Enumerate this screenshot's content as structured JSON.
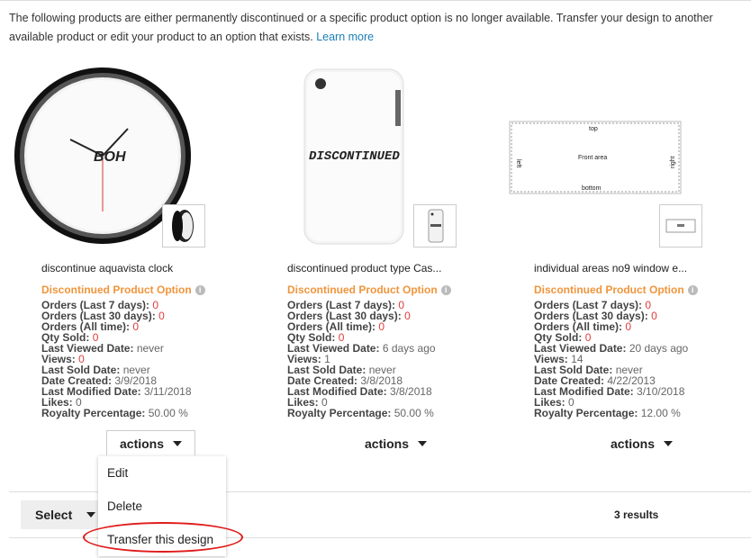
{
  "notice": {
    "text": "The following products are either permanently discontinued or a specific product option is no longer available. Transfer your design to another available product or edit your product to an option that exists.",
    "link": "Learn more"
  },
  "products": [
    {
      "name": "discontinue aquavista clock",
      "clock_text": "BOH",
      "status": "Discontinued Product Option",
      "stats": [
        {
          "k": "Orders (Last 7 days):",
          "v": "0",
          "red": true
        },
        {
          "k": "Orders (Last 30 days):",
          "v": "0",
          "red": true
        },
        {
          "k": "Orders (All time):",
          "v": "0",
          "red": true
        },
        {
          "k": "Qty Sold:",
          "v": "0",
          "red": true
        },
        {
          "k": "Last Viewed Date:",
          "v": "never",
          "red": false
        },
        {
          "k": "Views:",
          "v": "0",
          "red": true
        },
        {
          "k": "Last Sold Date:",
          "v": "never",
          "red": false
        },
        {
          "k": "Date Created:",
          "v": "3/9/2018",
          "red": false
        },
        {
          "k": "Last Modified Date:",
          "v": "3/11/2018",
          "red": false
        },
        {
          "k": "Likes:",
          "v": "0",
          "red": false
        },
        {
          "k": "Royalty Percentage:",
          "v": "50.00 %",
          "red": false
        }
      ],
      "actions": "actions"
    },
    {
      "name": "discontinued product type Cas...",
      "case_text": "DISCONTINUED",
      "status": "Discontinued Product Option",
      "stats": [
        {
          "k": "Orders (Last 7 days):",
          "v": "0",
          "red": true
        },
        {
          "k": "Orders (Last 30 days):",
          "v": "0",
          "red": true
        },
        {
          "k": "Orders (All time):",
          "v": "0",
          "red": true
        },
        {
          "k": "Qty Sold:",
          "v": "0",
          "red": true
        },
        {
          "k": "Last Viewed Date:",
          "v": "6 days ago",
          "red": false
        },
        {
          "k": "Views:",
          "v": "1",
          "red": false
        },
        {
          "k": "Last Sold Date:",
          "v": "never",
          "red": false
        },
        {
          "k": "Date Created:",
          "v": "3/8/2018",
          "red": false
        },
        {
          "k": "Last Modified Date:",
          "v": "3/8/2018",
          "red": false
        },
        {
          "k": "Likes:",
          "v": "0",
          "red": false
        },
        {
          "k": "Royalty Percentage:",
          "v": "50.00 %",
          "red": false
        }
      ],
      "actions": "actions"
    },
    {
      "name": "individual areas no9 window e...",
      "panel_labels": {
        "top": "top",
        "left": "left",
        "right": "right",
        "bottom": "bottom",
        "front": "Front area"
      },
      "status": "Discontinued Product Option",
      "stats": [
        {
          "k": "Orders (Last 7 days):",
          "v": "0",
          "red": true
        },
        {
          "k": "Orders (Last 30 days):",
          "v": "0",
          "red": true
        },
        {
          "k": "Orders (All time):",
          "v": "0",
          "red": true
        },
        {
          "k": "Qty Sold:",
          "v": "0",
          "red": true
        },
        {
          "k": "Last Viewed Date:",
          "v": "20 days ago",
          "red": false
        },
        {
          "k": "Views:",
          "v": "14",
          "red": false
        },
        {
          "k": "Last Sold Date:",
          "v": "never",
          "red": false
        },
        {
          "k": "Date Created:",
          "v": "4/22/2013",
          "red": false
        },
        {
          "k": "Last Modified Date:",
          "v": "3/10/2018",
          "red": false
        },
        {
          "k": "Likes:",
          "v": "0",
          "red": false
        },
        {
          "k": "Royalty Percentage:",
          "v": "12.00 %",
          "red": false
        }
      ],
      "actions": "actions"
    }
  ],
  "menu": {
    "items": [
      "Edit",
      "Delete",
      "Transfer this design"
    ]
  },
  "footer": {
    "select_label": "Select",
    "results": "3 results"
  },
  "colors": {
    "status": "#f0953c",
    "link": "#1a7fb5",
    "zero": "#e23c3c",
    "highlight": "#e01b1b"
  }
}
